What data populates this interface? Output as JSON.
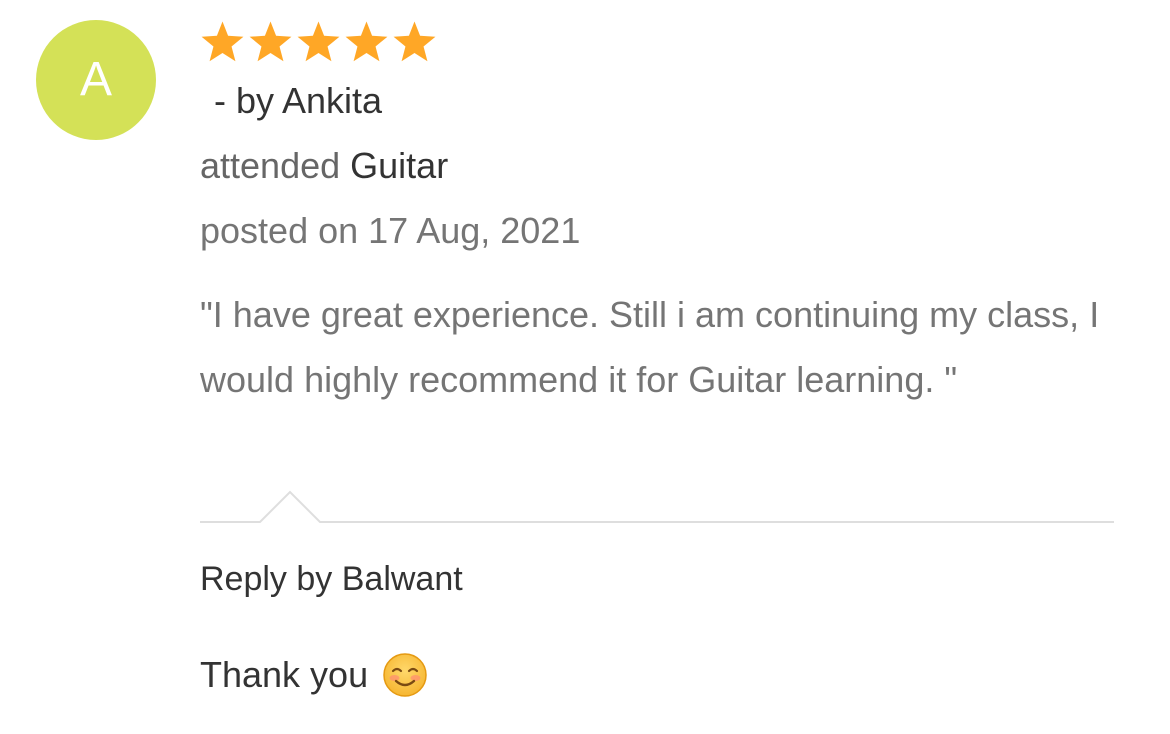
{
  "review": {
    "avatar": {
      "initial": "A",
      "color": "#d4e157"
    },
    "rating": {
      "value": 5,
      "max": 5,
      "color": "#ffa726"
    },
    "author_text": "- by Ankita",
    "attended_prefix": "attended",
    "course": "Guitar",
    "posted_text": "posted on 17 Aug, 2021",
    "comment": "\"I have great experience. Still i am continuing my class, I would highly recommend it for Guitar learning. \""
  },
  "reply": {
    "label": "Reply by Balwant",
    "text": "Thank you",
    "emoji_icon": "smiling-face-emoji-icon"
  }
}
